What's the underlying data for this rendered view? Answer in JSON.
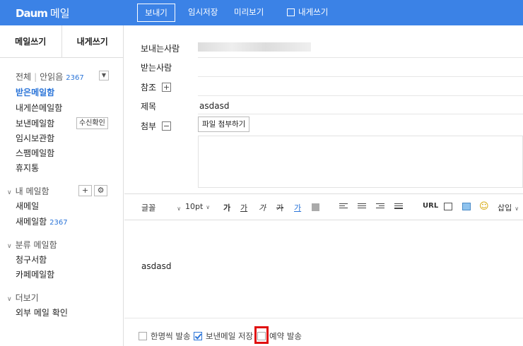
{
  "brand": {
    "logo": "Daum",
    "service": "메일"
  },
  "toolbar_top": {
    "send": "보내기",
    "draft": "임시저장",
    "preview": "미리보기",
    "self": "내게쓰기"
  },
  "sidebar": {
    "tabs": [
      "메일쓰기",
      "내게쓰기"
    ],
    "all": "전체",
    "unread": "안읽음",
    "unread_count": "2367",
    "folders": [
      "받은메일함",
      "내게쓴메일함",
      "보낸메일함",
      "임시보관함",
      "스팸메일함",
      "휴지통"
    ],
    "receipt_button": "수신확인",
    "my_mailbox": {
      "title": "내 메일함",
      "items": [
        "새메일",
        "새메일함"
      ],
      "count": "2367"
    },
    "category": {
      "title": "분류 메일함",
      "items": [
        "청구서함",
        "카페메일함"
      ]
    },
    "more": {
      "title": "더보기",
      "items": [
        "외부 메일 확인"
      ]
    }
  },
  "compose": {
    "from_label": "보내는사람",
    "to_label": "받는사람",
    "cc_label": "참조",
    "subject_label": "제목",
    "subject_value": "asdasd",
    "attach_label": "첨부",
    "attach_button": "파일 첨부하기",
    "body": "asdasd"
  },
  "editor_toolbar": {
    "font": "글꼴",
    "size": "10pt",
    "bold": "가",
    "underline": "가",
    "italic": "가",
    "strike": "가",
    "color": "가",
    "url": "URL",
    "insert": "삽입"
  },
  "options": {
    "individual": "한명씩 발송",
    "save_sent": "보낸메일 저장",
    "reserve": "예약 발송"
  },
  "colors": {
    "accent": "#3b82e6",
    "link": "#2a74d8",
    "highlight": "#e01010"
  }
}
